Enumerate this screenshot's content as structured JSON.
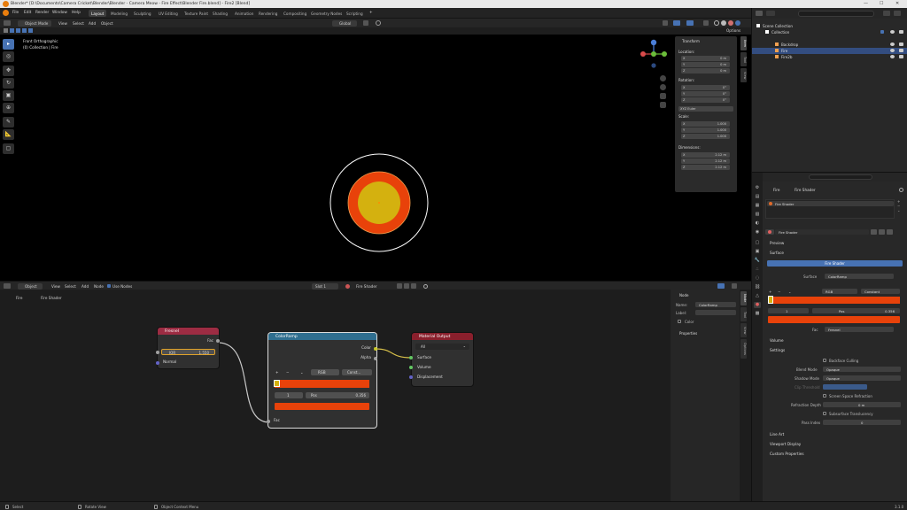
{
  "titlebar": {
    "title": "Blender* [D:\\Documents\\Camera Cricket\\Blender\\Blender - Camera Meow - Fire Effect\\Blender Fire.blend] - Fire2 [Blend]",
    "min": "—",
    "max": "☐",
    "close": "✕"
  },
  "menu": [
    "File",
    "Edit",
    "Render",
    "Window",
    "Help"
  ],
  "workspaces": [
    "Layout",
    "Modeling",
    "Sculpting",
    "UV Editing",
    "Texture Paint",
    "Shading",
    "Animation",
    "Rendering",
    "Compositing",
    "Geometry Nodes",
    "Scripting"
  ],
  "workspace_active": "Layout",
  "scene": {
    "label": "Scene",
    "view_layer": "ViewLayer"
  },
  "viewport": {
    "mode": "Object Mode",
    "menus": [
      "View",
      "Select",
      "Add",
      "Object"
    ],
    "orientation": "Global",
    "overlay_title": "Front Orthographic",
    "overlay_sub": "(0) Collection | Fire",
    "options_label": "Options",
    "colors": {
      "outer_ring": "#ffffff",
      "orange": "#e8420a",
      "yellow": "#d4b10f"
    }
  },
  "npanel": {
    "title": "Transform",
    "location": {
      "label": "Location:",
      "rows": [
        {
          "k": "X",
          "v": "0 m"
        },
        {
          "k": "Y",
          "v": "0 m"
        },
        {
          "k": "Z",
          "v": "0 m"
        }
      ]
    },
    "rotation": {
      "label": "Rotation:",
      "rows": [
        {
          "k": "X",
          "v": "0°"
        },
        {
          "k": "Y",
          "v": "0°"
        },
        {
          "k": "Z",
          "v": "0°"
        }
      ]
    },
    "rot_mode": "XYZ Euler",
    "scale": {
      "label": "Scale:",
      "rows": [
        {
          "k": "X",
          "v": "1.000"
        },
        {
          "k": "Y",
          "v": "1.000"
        },
        {
          "k": "Z",
          "v": "1.000"
        }
      ]
    },
    "dimensions": {
      "label": "Dimensions:",
      "rows": [
        {
          "k": "X",
          "v": "2.12 m"
        },
        {
          "k": "Y",
          "v": "2.12 m"
        },
        {
          "k": "Z",
          "v": "2.12 m"
        }
      ]
    },
    "tabs": [
      "Item",
      "Tool",
      "View"
    ]
  },
  "node_editor": {
    "type": "Object",
    "menus": [
      "View",
      "Select",
      "Add",
      "Node"
    ],
    "use_nodes": "Use Nodes",
    "slot": "Slot 1",
    "material": "Fire Shader",
    "breadcrumb": [
      "Fire",
      "Fire Shader"
    ],
    "nodes": {
      "fresnel": {
        "title": "Fresnel",
        "out": "Fac",
        "ior_label": "IOR",
        "ior_value": "1.550",
        "normal": "Normal"
      },
      "colorramp": {
        "title": "ColorRamp",
        "color": "Color",
        "alpha": "Alpha",
        "mode": "RGB",
        "interp": "Const...",
        "index": "1",
        "pos_label": "Pos",
        "pos_value": "0.356",
        "fac": "Fac"
      },
      "output": {
        "title": "Material Output",
        "target": "All",
        "surface": "Surface",
        "volume": "Volume",
        "displacement": "Displacement"
      }
    },
    "sidebar": {
      "title": "Node",
      "name_label": "Name:",
      "name_value": "ColorRamp",
      "label_label": "Label:",
      "color_label": "Color",
      "properties": "Properties",
      "tabs": [
        "Node",
        "Tool",
        "View",
        "Options"
      ]
    },
    "colors": {
      "fresnel_header": "#9d2c43",
      "colorramp_header": "#2f6e8f",
      "output_header": "#8a1f2c",
      "ramp": "#e8420a"
    }
  },
  "outliner": {
    "search_placeholder": "",
    "rows": [
      {
        "label": "Scene Collection",
        "indent": 0
      },
      {
        "label": "Collection",
        "indent": 1
      },
      {
        "label": "Backdrop",
        "indent": 2
      },
      {
        "label": "Fire",
        "indent": 2
      },
      {
        "label": "Fire2b",
        "indent": 2
      }
    ]
  },
  "properties": {
    "breadcrumb": [
      "Fire",
      "Fire Shader"
    ],
    "material_slot": "Fire Shader",
    "material_name": "Fire Shader",
    "sections": {
      "preview": "Preview",
      "surface": "Surface",
      "surface_btn": "Fire Shader",
      "surface_label": "Surface",
      "surface_value": "ColorRamp",
      "ramp_mode": "RGB",
      "ramp_interp": "Constant",
      "ramp_index": "1",
      "ramp_pos_label": "Pos",
      "ramp_pos": "0.356",
      "fac_label": "Fac",
      "fac_value": "Fresnel",
      "volume": "Volume",
      "settings": "Settings",
      "backface": "Backface Culling",
      "blend_label": "Blend Mode",
      "blend_value": "Opaque",
      "shadow_label": "Shadow Mode",
      "shadow_value": "Opaque",
      "clip_label": "Clip Threshold",
      "ssr": "Screen Space Refraction",
      "refr_label": "Refraction Depth",
      "refr_value": "0 m",
      "sss": "Subsurface Translucency",
      "pass_label": "Pass Index",
      "pass_value": "0",
      "lineart": "Line Art",
      "viewport_display": "Viewport Display",
      "custom_props": "Custom Properties"
    }
  },
  "statusbar": {
    "select": "Select",
    "rotate": "Rotate View",
    "context": "Object Context Menu",
    "version": "3.1.0"
  }
}
